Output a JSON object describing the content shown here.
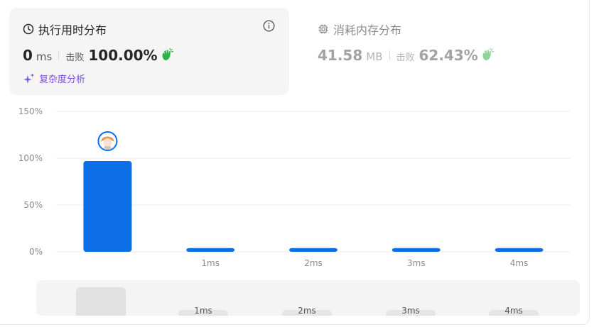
{
  "runtime_card": {
    "title": "执行用时分布",
    "value": "0",
    "unit": "ms",
    "beat_label": "击败",
    "beat_value": "100.00%",
    "complexity_link": "复杂度分析"
  },
  "memory_card": {
    "title": "消耗内存分布",
    "value": "41.58",
    "unit": "MB",
    "beat_label": "击败",
    "beat_value": "62.43%"
  },
  "colors": {
    "bar": "#0d6fe8",
    "accent_purple": "#7c4ddd",
    "clap_green": "#2fb344"
  },
  "chart_data": {
    "type": "bar",
    "categories": [
      "",
      "1ms",
      "2ms",
      "3ms",
      "4ms"
    ],
    "values": [
      97,
      4,
      4,
      4,
      4
    ],
    "ylim": [
      0,
      150
    ],
    "yticks": [
      "0%",
      "50%",
      "100%",
      "150%"
    ],
    "ytick_values": [
      0,
      50,
      100,
      150
    ],
    "grid": true,
    "marker_on_category": 0,
    "marker": "user-avatar"
  },
  "scrubber": {
    "labels": [
      "1ms",
      "2ms",
      "3ms",
      "4ms"
    ]
  }
}
